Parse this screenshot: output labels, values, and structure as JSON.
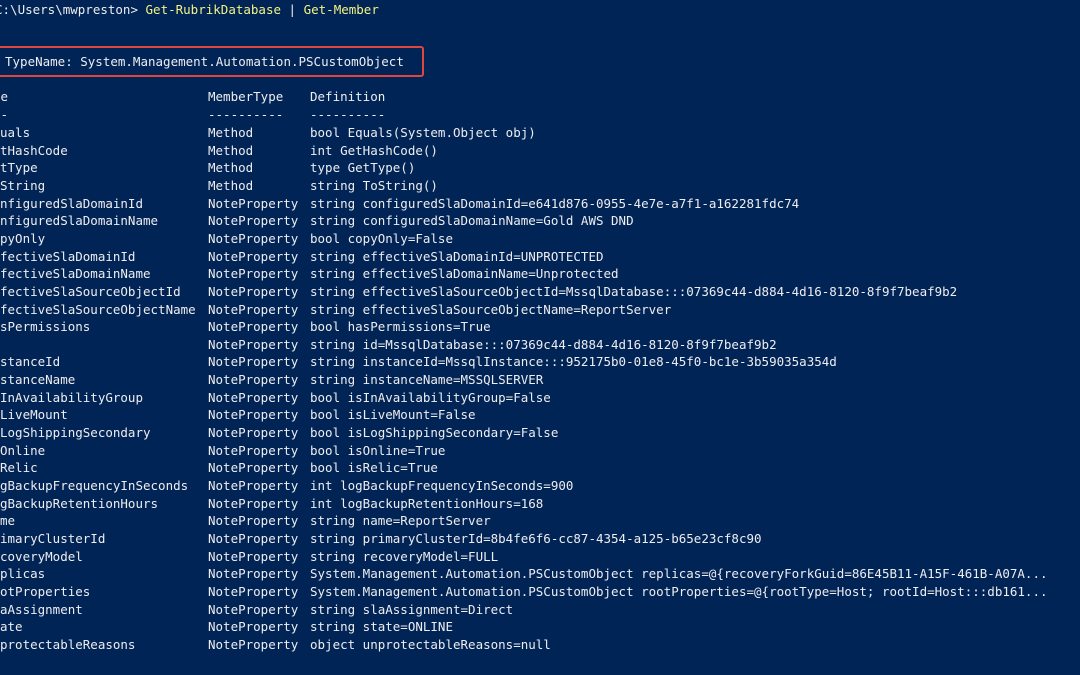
{
  "window": {
    "kind": "PowerShell console",
    "background_color": "#012456",
    "text_color": "#eeedf0",
    "command_color": "#f3f383",
    "highlight_box_color": "#e0463f"
  },
  "prompt": {
    "path": "C:\\Users\\mwpreston>",
    "command": "Get-RubrikDatabase",
    "pipe": "|",
    "command2": "Get-Member"
  },
  "typename": "TypeName: System.Management.Automation.PSCustomObject",
  "headers": {
    "name": "me",
    "membertype": "MemberType",
    "definition": "Definition"
  },
  "separators": {
    "name": "--",
    "membertype": "----------",
    "definition": "----------"
  },
  "rows": [
    {
      "name": "uals",
      "type": "Method",
      "def": "bool Equals(System.Object obj)"
    },
    {
      "name": "tHashCode",
      "type": "Method",
      "def": "int GetHashCode()"
    },
    {
      "name": "tType",
      "type": "Method",
      "def": "type GetType()"
    },
    {
      "name": "String",
      "type": "Method",
      "def": "string ToString()"
    },
    {
      "name": "nfiguredSlaDomainId",
      "type": "NoteProperty",
      "def": "string configuredSlaDomainId=e641d876-0955-4e7e-a7f1-a162281fdc74"
    },
    {
      "name": "nfiguredSlaDomainName",
      "type": "NoteProperty",
      "def": "string configuredSlaDomainName=Gold AWS DND"
    },
    {
      "name": "pyOnly",
      "type": "NoteProperty",
      "def": "bool copyOnly=False"
    },
    {
      "name": "fectiveSlaDomainId",
      "type": "NoteProperty",
      "def": "string effectiveSlaDomainId=UNPROTECTED"
    },
    {
      "name": "fectiveSlaDomainName",
      "type": "NoteProperty",
      "def": "string effectiveSlaDomainName=Unprotected"
    },
    {
      "name": "fectiveSlaSourceObjectId",
      "type": "NoteProperty",
      "def": "string effectiveSlaSourceObjectId=MssqlDatabase:::07369c44-d884-4d16-8120-8f9f7beaf9b2"
    },
    {
      "name": "fectiveSlaSourceObjectName",
      "type": "NoteProperty",
      "def": "string effectiveSlaSourceObjectName=ReportServer"
    },
    {
      "name": "sPermissions",
      "type": "NoteProperty",
      "def": "bool hasPermissions=True"
    },
    {
      "name": "",
      "type": "NoteProperty",
      "def": "string id=MssqlDatabase:::07369c44-d884-4d16-8120-8f9f7beaf9b2"
    },
    {
      "name": "stanceId",
      "type": "NoteProperty",
      "def": "string instanceId=MssqlInstance:::952175b0-01e8-45f0-bc1e-3b59035a354d"
    },
    {
      "name": "stanceName",
      "type": "NoteProperty",
      "def": "string instanceName=MSSQLSERVER"
    },
    {
      "name": "InAvailabilityGroup",
      "type": "NoteProperty",
      "def": "bool isInAvailabilityGroup=False"
    },
    {
      "name": "LiveMount",
      "type": "NoteProperty",
      "def": "bool isLiveMount=False"
    },
    {
      "name": "LogShippingSecondary",
      "type": "NoteProperty",
      "def": "bool isLogShippingSecondary=False"
    },
    {
      "name": "Online",
      "type": "NoteProperty",
      "def": "bool isOnline=True"
    },
    {
      "name": "Relic",
      "type": "NoteProperty",
      "def": "bool isRelic=True"
    },
    {
      "name": "gBackupFrequencyInSeconds",
      "type": "NoteProperty",
      "def": "int logBackupFrequencyInSeconds=900"
    },
    {
      "name": "gBackupRetentionHours",
      "type": "NoteProperty",
      "def": "int logBackupRetentionHours=168"
    },
    {
      "name": "me",
      "type": "NoteProperty",
      "def": "string name=ReportServer"
    },
    {
      "name": "imaryClusterId",
      "type": "NoteProperty",
      "def": "string primaryClusterId=8b4fe6f6-cc87-4354-a125-b65e23cf8c90"
    },
    {
      "name": "coveryModel",
      "type": "NoteProperty",
      "def": "string recoveryModel=FULL"
    },
    {
      "name": "plicas",
      "type": "NoteProperty",
      "def": "System.Management.Automation.PSCustomObject replicas=@{recoveryForkGuid=86E45B11-A15F-461B-A07A..."
    },
    {
      "name": "otProperties",
      "type": "NoteProperty",
      "def": "System.Management.Automation.PSCustomObject rootProperties=@{rootType=Host; rootId=Host:::db161..."
    },
    {
      "name": "aAssignment",
      "type": "NoteProperty",
      "def": "string slaAssignment=Direct"
    },
    {
      "name": "ate",
      "type": "NoteProperty",
      "def": "string state=ONLINE"
    },
    {
      "name": "protectableReasons",
      "type": "NoteProperty",
      "def": "object unprotectableReasons=null"
    }
  ]
}
